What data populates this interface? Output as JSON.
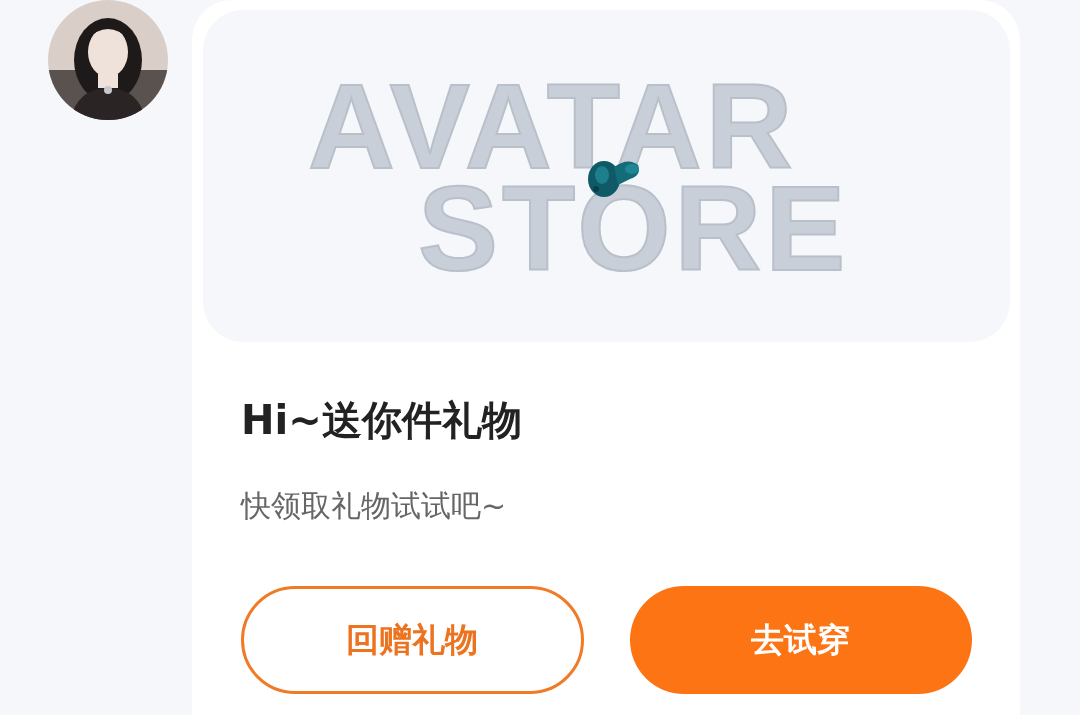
{
  "message": {
    "card": {
      "banner_text": [
        "AVATAR",
        "STORE"
      ],
      "title": "Hi~送你件礼物",
      "subtitle": "快领取礼物试试吧~",
      "buttons": [
        {
          "label": "回赠礼物",
          "kind": "outline"
        },
        {
          "label": "去试穿",
          "kind": "filled"
        }
      ]
    }
  }
}
